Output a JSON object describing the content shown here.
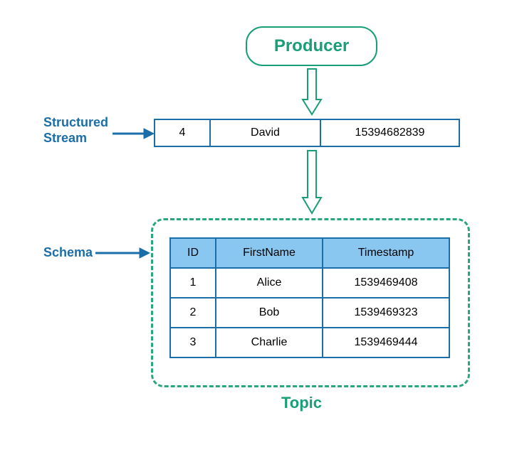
{
  "producer_label": "Producer",
  "stream_label_line1": "Structured",
  "stream_label_line2": "Stream",
  "schema_label": "Schema",
  "topic_label": "Topic",
  "stream_row": {
    "id": "4",
    "first_name": "David",
    "timestamp": "15394682839"
  },
  "schema": {
    "columns": {
      "id": "ID",
      "first_name": "FirstName",
      "timestamp": "Timestamp"
    },
    "rows": [
      {
        "id": "1",
        "first_name": "Alice",
        "timestamp": "1539469408"
      },
      {
        "id": "2",
        "first_name": "Bob",
        "timestamp": "1539469323"
      },
      {
        "id": "3",
        "first_name": "Charlie",
        "timestamp": "1539469444"
      }
    ]
  },
  "colors": {
    "green": "#189e78",
    "blue": "#1b6ea8",
    "header_fill": "#8ac7f0"
  }
}
